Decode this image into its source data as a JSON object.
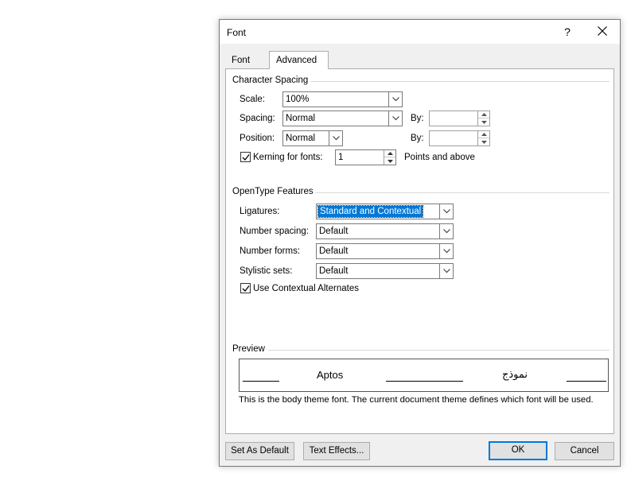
{
  "dialog": {
    "title": "Font",
    "help": "?",
    "tabs": [
      "Font",
      "Advanced"
    ]
  },
  "character_spacing": {
    "heading": "Character Spacing",
    "scale_label": "Scale:",
    "scale_value": "100%",
    "spacing_label": "Spacing:",
    "spacing_value": "Normal",
    "spacing_by_label": "By:",
    "spacing_by_value": "",
    "position_label": "Position:",
    "position_value": "Normal",
    "position_by_label": "By:",
    "position_by_value": "",
    "kerning_label": "Kerning for fonts:",
    "kerning_checked": true,
    "kerning_value": "1",
    "kerning_suffix": "Points and above"
  },
  "opentype": {
    "heading": "OpenType Features",
    "ligatures_label": "Ligatures:",
    "ligatures_value": "Standard and Contextual",
    "number_spacing_label": "Number spacing:",
    "number_spacing_value": "Default",
    "number_forms_label": "Number forms:",
    "number_forms_value": "Default",
    "stylistic_sets_label": "Stylistic sets:",
    "stylistic_sets_value": "Default",
    "contextual_label": "Use Contextual Alternates",
    "contextual_checked": true
  },
  "preview": {
    "heading": "Preview",
    "latin_sample": "Aptos",
    "arabic_sample": "نموذج",
    "caption": "This is the body theme font. The current document theme defines which font will be used."
  },
  "buttons": {
    "set_default": "Set As Default",
    "text_effects": "Text Effects...",
    "ok": "OK",
    "cancel": "Cancel"
  },
  "colors": {
    "accent": "#0078d7",
    "dialog_bg": "#f0f0f0",
    "panel_bg": "#ffffff"
  }
}
